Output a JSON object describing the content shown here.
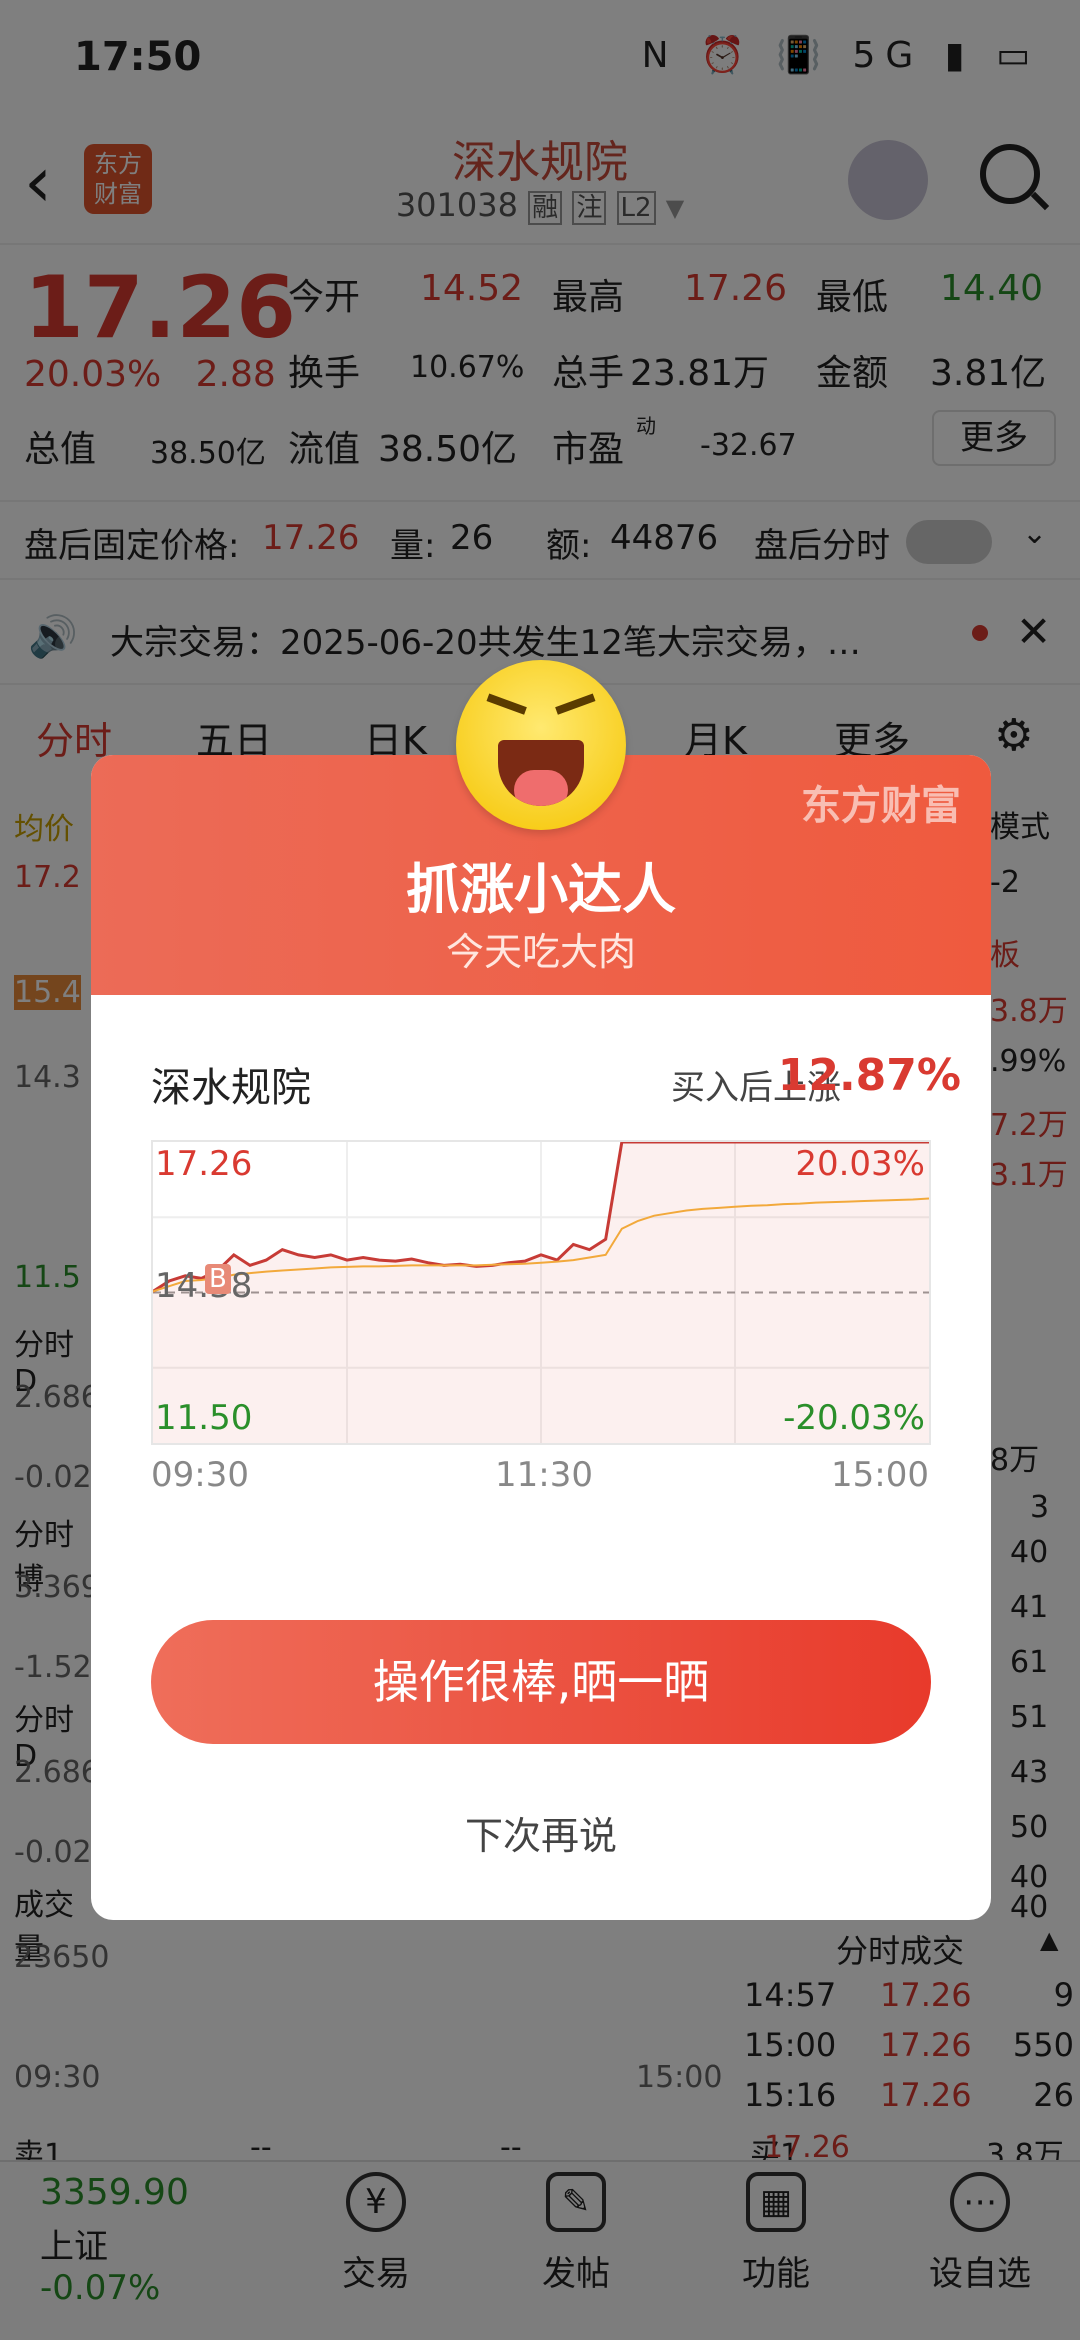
{
  "status": {
    "time": "17:50",
    "icons": "N ⏰ 📳 5G ▮ ▭"
  },
  "header": {
    "brand_logo": "东方\n财富",
    "stock_name": "深水规院",
    "stock_code": "301038",
    "badges": [
      "融",
      "注",
      "L2"
    ]
  },
  "quote": {
    "price": "17.26",
    "change_pct": "20.03%",
    "change_val": "2.88",
    "open_label": "今开",
    "open": "14.52",
    "high_label": "最高",
    "high": "17.26",
    "low_label": "最低",
    "low": "14.40",
    "turnover_label": "换手",
    "turnover": "10.67%",
    "volume_label": "总手",
    "volume": "23.81万",
    "amount_label": "金额",
    "amount": "3.81亿",
    "mktcap_label": "总值",
    "mktcap": "38.50亿",
    "float_label": "流值",
    "float": "38.50亿",
    "pe_label": "市盈",
    "pe_sup": "动",
    "pe": "-32.67",
    "more": "更多"
  },
  "afterhours": {
    "price_label": "盘后固定价格:",
    "price": "17.26",
    "qty_label": "量:",
    "qty": "26",
    "amt_label": "额:",
    "amt": "44876",
    "toggle_label": "盘后分时"
  },
  "notice": {
    "text": "大宗交易：2025-06-20共发生12笔大宗交易，…"
  },
  "tabs": [
    "分时",
    "五日",
    "日K",
    "月K",
    "更多"
  ],
  "background_left": [
    "均价",
    "17.2",
    "15.4",
    "14.3",
    "11.5",
    "分时D",
    "2.686",
    "-0.02",
    "分时博",
    "3.369",
    "-1.52",
    "分时D",
    "2.686",
    "-0.02",
    "成交量",
    "23650",
    "09:30",
    "15:00",
    "卖1",
    "--",
    "--"
  ],
  "background_right": [
    "模式",
    "-2",
    "板",
    "3.8万",
    ".99%",
    "7.2万",
    "3.1万",
    "8万",
    "3",
    "40",
    "41",
    "61",
    "51",
    "43",
    "50",
    "40",
    "40",
    "买1",
    "17.26",
    "3.8万"
  ],
  "tick_header": "分时成交",
  "ticks": [
    {
      "time": "14:57",
      "price": "17.26",
      "vol": "9"
    },
    {
      "time": "15:00",
      "price": "17.26",
      "vol": "550"
    },
    {
      "time": "15:16",
      "price": "17.26",
      "vol": "26"
    }
  ],
  "modal": {
    "brand": "东方财富",
    "title": "抓涨小达人",
    "subtitle": "今天吃大肉",
    "stock_name": "深水规院",
    "rise_label": "买入后上涨",
    "rise_value": "12.87%",
    "share_button": "操作很棒,晒一晒",
    "later": "下次再说"
  },
  "chart_data": {
    "type": "line",
    "x_ticks": [
      "09:30",
      "11:30",
      "15:00"
    ],
    "y_ticks": [
      "17.26",
      "14.38",
      "11.50"
    ],
    "pct_ticks": [
      "20.03%",
      "-20.03%"
    ],
    "buy_marker": "B",
    "ylim": [
      11.5,
      17.26
    ],
    "prev_close": 14.38,
    "x": [
      0,
      5,
      10,
      15,
      20,
      25,
      30,
      35,
      40,
      45,
      50,
      55,
      60,
      65,
      70,
      75,
      80,
      85,
      90,
      95,
      100,
      105,
      110,
      115,
      120,
      125,
      130,
      135,
      140,
      145,
      150,
      155,
      160,
      165,
      170,
      175,
      180,
      185,
      190,
      195,
      200,
      205,
      210,
      215,
      220,
      225,
      230,
      235,
      240
    ],
    "series": [
      {
        "values": [
          14.4,
          14.6,
          14.7,
          14.65,
          14.8,
          15.1,
          14.9,
          15.0,
          15.2,
          15.1,
          15.05,
          15.1,
          15.0,
          15.05,
          15.0,
          14.98,
          15.02,
          14.95,
          14.9,
          14.92,
          14.88,
          14.9,
          14.95,
          14.98,
          15.1,
          15.0,
          15.3,
          15.2,
          15.4,
          17.26,
          17.26,
          17.26,
          17.26,
          17.26,
          17.26,
          17.26,
          17.26,
          17.26,
          17.26,
          17.26,
          17.26,
          17.26,
          17.26,
          17.26,
          17.26,
          17.26,
          17.26,
          17.26,
          17.26
        ],
        "color": "#c73b36"
      },
      {
        "values": [
          14.4,
          14.5,
          14.6,
          14.62,
          14.66,
          14.72,
          14.75,
          14.78,
          14.8,
          14.82,
          14.84,
          14.86,
          14.87,
          14.88,
          14.88,
          14.89,
          14.9,
          14.9,
          14.9,
          14.9,
          14.9,
          14.91,
          14.92,
          14.93,
          14.95,
          14.97,
          15.0,
          15.05,
          15.1,
          15.6,
          15.75,
          15.85,
          15.9,
          15.95,
          15.98,
          16.0,
          16.02,
          16.04,
          16.05,
          16.07,
          16.08,
          16.1,
          16.11,
          16.12,
          16.13,
          16.14,
          16.15,
          16.16,
          16.18
        ],
        "color": "#f2a93b"
      }
    ]
  }
}
